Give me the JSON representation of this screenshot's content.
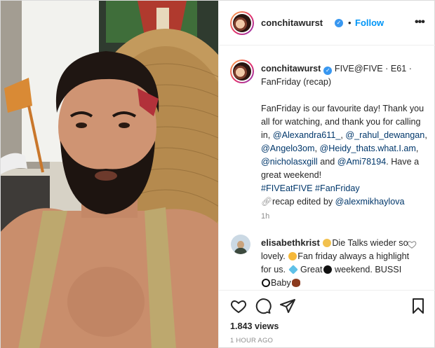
{
  "header": {
    "username": "conchitawurst",
    "verified_icon": "verified-badge-icon",
    "separator": "•",
    "follow_label": "Follow",
    "more_label": "•••"
  },
  "caption": {
    "username": "conchitawurst",
    "title": "FIVE@FIVE · E61 · FanFriday (recap)",
    "body_intro": "FanFriday is our favourite day! Thank you all for watching, and thank you for calling in, ",
    "mentions": [
      "@Alexandra611_",
      "@_rahul_dewangan",
      "@Angelo3om",
      "@Heidy_thats.what.I.am",
      "@nicholasxgill",
      "@Ami78194"
    ],
    "comma": ",",
    "and": "and",
    "outro": ". Have a great weekend!",
    "hashtags": [
      "#FIVEatFIVE",
      "#FanFriday"
    ],
    "recap_icon": "link-icon",
    "recap_text": "recap edited by",
    "recap_mention": "@alexmikhaylova",
    "time": "1h"
  },
  "comment": {
    "username": "elisabethkrist",
    "text_1": "Die Talks wieder so lovely.",
    "text_2": "Fan friday always a highlight for us.",
    "text_3": "Great",
    "text_4": "weekend. BUSSI",
    "text_5": "Baby",
    "emojis": [
      "ok-hand-emoji",
      "clapping-hands-emoji",
      "gem-emoji",
      "black-heart-emoji",
      "panda-emoji",
      "rugby-ball-emoji"
    ]
  },
  "actions": {
    "icons": [
      "heart-icon",
      "comment-icon",
      "share-icon",
      "bookmark-icon"
    ],
    "views": "1.843 views",
    "time_ago": "1 HOUR AGO"
  },
  "colors": {
    "accent": "#0095f6",
    "link": "#00376b",
    "muted": "#8e8e8e",
    "text": "#262626",
    "verified": "#3897f0"
  }
}
